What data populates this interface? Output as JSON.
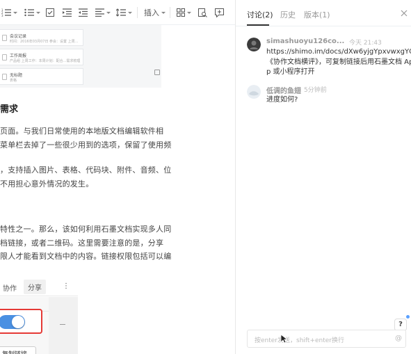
{
  "toolbar": {
    "insert_label": "插入"
  },
  "doc": {
    "thumbs": [
      {
        "title": "会议记录",
        "sub": "时间：2016年03月07日 参会：设置 上周..."
      },
      {
        "title": "工作周报",
        "sub": "产品组 上周工作：本周计划：配合...需求梳理"
      },
      {
        "title": "无标题",
        "sub": "表格"
      }
    ],
    "heading": "需求",
    "paragraphs": [
      "页面。与我们日常使用的本地版文档编辑软件相",
      "菜单栏去掉了一些很少用到的选项，保留了使用频",
      "，支持插入图片、表格、代码块、附件、音频、位",
      "不用担心意外情况的发生。",
      "特性之一。那么，该如何利用石墨文档实现多人同",
      "档链接，或者二维码。这里需要注意的是，分享",
      "限人才能看到文档中的内容。链接权限包括可以编"
    ],
    "share_tabs": {
      "collab": "协作",
      "share": "分享",
      "more": "⋮"
    },
    "copy_link": "复制链接"
  },
  "panel": {
    "tabs": [
      {
        "label": "讨论(2)",
        "active": true
      },
      {
        "label": "历史",
        "active": false
      },
      {
        "label": "版本(1)",
        "active": false
      }
    ],
    "comments": [
      {
        "author": "simashuoyu126co...",
        "time": "今天 21:43",
        "lines": [
          "https://shimo.im/docs/dXw6yjgYpxvwxgYQ/",
          "《协作文档横评》，可复制链接后用石墨文档 Ap",
          "p 或小程序打开"
        ]
      },
      {
        "author": "低调的鱼翅",
        "time": "5分钟前",
        "lines": [
          "进度如何?"
        ]
      }
    ],
    "input_placeholder": "按enter发送，shift+enter换行",
    "help_label": "?"
  },
  "colors": {
    "accent": "#4a90e2",
    "highlight": "#e53935"
  }
}
